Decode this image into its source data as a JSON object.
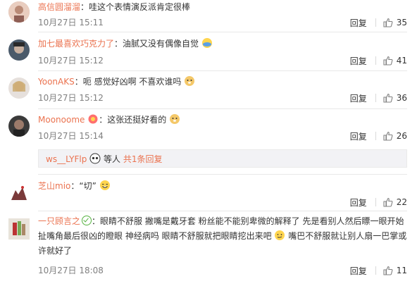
{
  "colors": {
    "username": "#eb7350",
    "meta": "#808080",
    "sub_bg": "#f2f2f5"
  },
  "labels": {
    "reply": "回复",
    "separator": "："
  },
  "comments": [
    {
      "user": "高信圆溜溜",
      "text": "哇这个表情演反派肯定很棒",
      "time": "10月27日 15:11",
      "likes": "35"
    },
    {
      "user": "加七最喜欢巧克力了",
      "text": "油腻又没有偶像自觉",
      "time": "10月27日 15:12",
      "likes": "41",
      "emoji": "face-palm-emoji"
    },
    {
      "user": "YoonAKS",
      "text": "呃 感觉好凶啊 不喜欢谁吗",
      "time": "10月27日 15:12",
      "likes": "36",
      "emoji": "doge-emoji"
    },
    {
      "user": "Moonoome",
      "text": "这张还挺好看的",
      "time": "10月27日 15:14",
      "likes": "26",
      "emoji": "doge-emoji",
      "sub": {
        "user": "ws__LYFlp",
        "suffix": "等人",
        "more": "共1条回复"
      }
    },
    {
      "user": "芝山mio",
      "text": "“切”",
      "time": "",
      "likes": "22",
      "emoji": "laugh-emoji"
    },
    {
      "user": "一只顾言之",
      "text_line1": "眼睛不舒服 撇嘴是戴牙套 粉丝能不能别卑微的解释了 先是看别人然后瞟一眼开始",
      "text_line2": "扯嘴角最后很凶的瞪眼 神经病吗 眼睛不舒服就把眼睛挖出来吧",
      "text_line3_after": "嘴巴不舒服就让别人扇一巴掌或",
      "text_line3": "许就好了",
      "time": "10月27日 18:08",
      "likes": "11"
    }
  ]
}
